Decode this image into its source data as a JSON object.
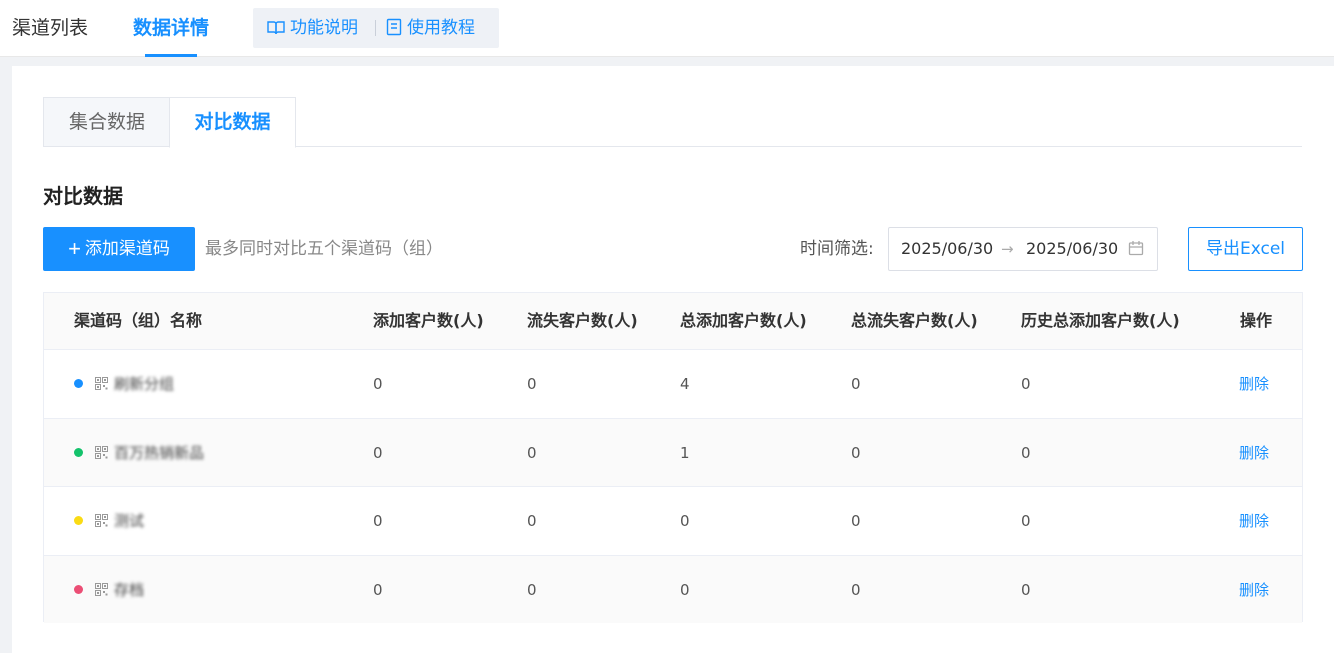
{
  "topbar": {
    "tabs": [
      {
        "label": "渠道列表"
      },
      {
        "label": "数据详情"
      }
    ],
    "help_links": [
      {
        "label": "功能说明",
        "icon": "book-icon"
      },
      {
        "label": "使用教程",
        "icon": "document-icon"
      }
    ]
  },
  "panel": {
    "tabs": [
      {
        "label": "集合数据"
      },
      {
        "label": "对比数据"
      }
    ],
    "section_title": "对比数据",
    "add_button": {
      "plus": "+",
      "label": "添加渠道码"
    },
    "hint": "最多同时对比五个渠道码（组）",
    "time_label": "时间筛选:",
    "date_start": "2025/06/30",
    "date_arrow": "→",
    "date_end": "2025/06/30",
    "export_label": "导出Excel"
  },
  "table": {
    "headers": [
      "渠道码（组）名称",
      "添加客户数(人)",
      "流失客户数(人)",
      "总添加客户数(人)",
      "总流失客户数(人)",
      "历史总添加客户数(人)",
      "操作"
    ],
    "rows": [
      {
        "color": "#1890ff",
        "name": "刷新分组",
        "values": [
          "0",
          "0",
          "4",
          "0",
          "0"
        ],
        "action": "删除"
      },
      {
        "color": "#13c26b",
        "name": "百万热销新品",
        "values": [
          "0",
          "0",
          "1",
          "0",
          "0"
        ],
        "action": "删除"
      },
      {
        "color": "#fadb14",
        "name": "测试",
        "values": [
          "0",
          "0",
          "0",
          "0",
          "0"
        ],
        "action": "删除"
      },
      {
        "color": "#eb4e75",
        "name": "存档",
        "values": [
          "0",
          "0",
          "0",
          "0",
          "0"
        ],
        "action": "删除"
      }
    ]
  }
}
